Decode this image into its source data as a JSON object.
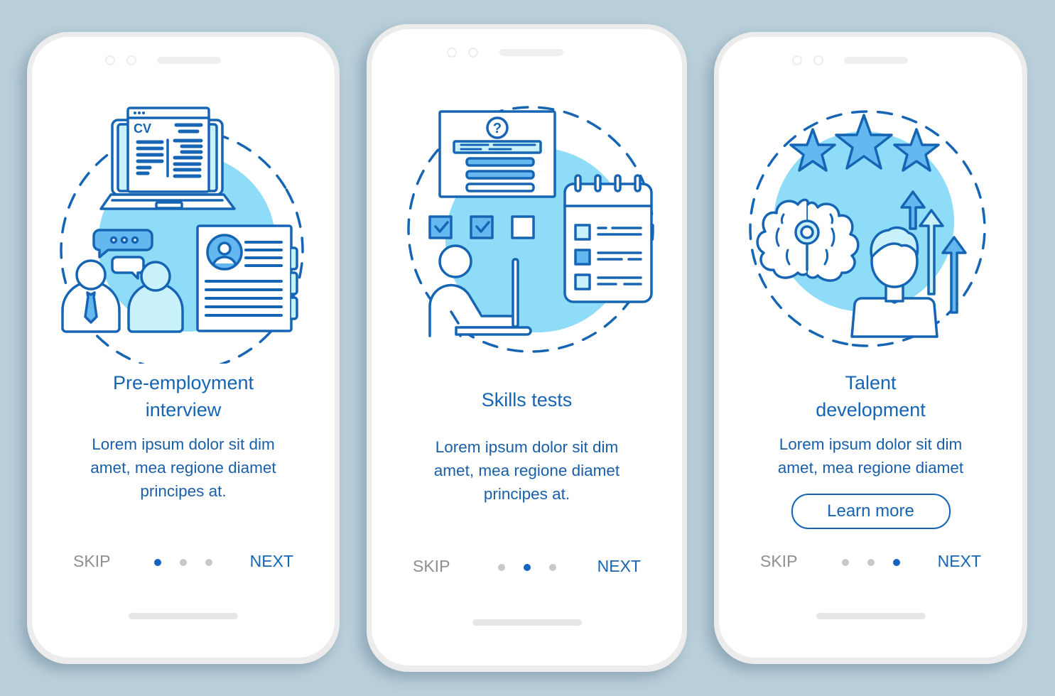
{
  "colors": {
    "background": "#b9cfda",
    "accent": "#1565b4",
    "light_blue": "#8edcf7",
    "skip_gray": "#8f8f8f",
    "dot_inactive": "#c8c8c8",
    "dot_active": "#1565c0"
  },
  "screens": [
    {
      "illustration": "pre-employment-interview-illustration",
      "cv_label": "CV",
      "title_line1": "Pre-employment",
      "title_line2": "interview",
      "desc_lines": [
        "Lorem ipsum dolor sit dim",
        "amet, mea regione diamet",
        "principes at."
      ],
      "skip_label": "SKIP",
      "next_label": "NEXT",
      "page_index": 1,
      "page_count": 3
    },
    {
      "illustration": "skills-tests-illustration",
      "question_mark": "?",
      "title_line1": "Skills tests",
      "desc_lines": [
        "Lorem ipsum dolor sit dim",
        "amet, mea regione diamet",
        "principes at."
      ],
      "skip_label": "SKIP",
      "next_label": "NEXT",
      "page_index": 2,
      "page_count": 3
    },
    {
      "illustration": "talent-development-illustration",
      "title_line1": "Talent",
      "title_line2": "development",
      "desc_lines": [
        "Lorem ipsum dolor sit dim",
        "amet, mea regione diamet"
      ],
      "button_label": "Learn more",
      "skip_label": "SKIP",
      "next_label": "NEXT",
      "page_index": 3,
      "page_count": 3
    }
  ]
}
